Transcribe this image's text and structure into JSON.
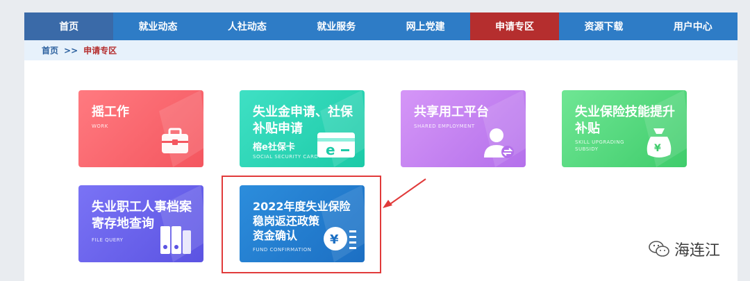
{
  "nav": {
    "items": [
      {
        "label": "首页"
      },
      {
        "label": "就业动态"
      },
      {
        "label": "人社动态"
      },
      {
        "label": "就业服务"
      },
      {
        "label": "网上党建"
      },
      {
        "label": "申请专区"
      },
      {
        "label": "资源下载"
      },
      {
        "label": "用户中心"
      }
    ]
  },
  "breadcrumb": {
    "home": "首页",
    "separator": ">>",
    "current": "申请专区"
  },
  "tiles": [
    {
      "title": "摇工作",
      "subtitle": "WORK"
    },
    {
      "title": "失业金申请、社保\n补贴申请",
      "extra": "榕e社保卡",
      "subtitle": "Social security card"
    },
    {
      "title": "共享用工平台",
      "subtitle": "Shared employment"
    },
    {
      "title": "失业保险技能提升\n补贴",
      "subtitle": "Skill upgrading subsidy"
    },
    {
      "title": "失业职工人事档案\n寄存地查询",
      "subtitle": "File query"
    },
    {
      "title": "2022年度失业保险\n稳岗返还政策\n资金确认",
      "subtitle": "Fund confirmation"
    }
  ],
  "watermark": {
    "text": "海连江"
  },
  "colors": {
    "nav": "#2e7cc6",
    "active": "#b52e2e",
    "highlight": "#e13a3a"
  }
}
